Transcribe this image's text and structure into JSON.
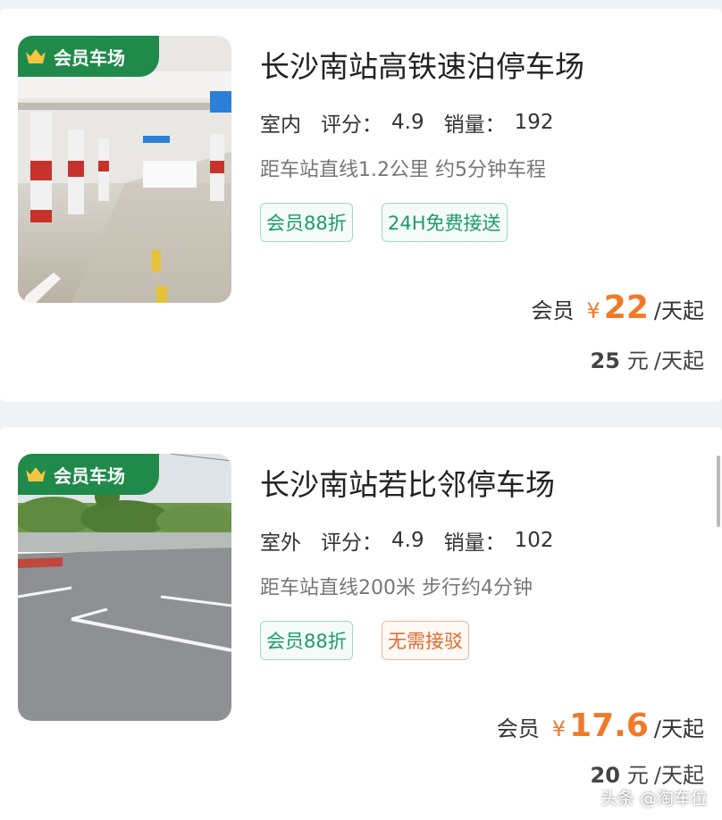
{
  "listings": [
    {
      "badge": "会员车场",
      "name": "长沙南站高铁速泊停车场",
      "environment": "室内",
      "rating_label": "评分：",
      "rating": "4.9",
      "sales_label": "销量：",
      "sales": "192",
      "distance": "距车站直线1.2公里 约5分钟车程",
      "tags": [
        {
          "text": "会员88折",
          "style": "green"
        },
        {
          "text": "24H免费接送",
          "style": "green"
        }
      ],
      "member_label": "会员",
      "currency": "¥",
      "member_price": "22",
      "per_day": "/天起",
      "original_price": "25",
      "yuan": "元"
    },
    {
      "badge": "会员车场",
      "name": "长沙南站若比邻停车场",
      "environment": "室外",
      "rating_label": "评分：",
      "rating": "4.9",
      "sales_label": "销量：",
      "sales": "102",
      "distance": "距车站直线200米 步行约4分钟",
      "tags": [
        {
          "text": "会员88折",
          "style": "green"
        },
        {
          "text": "无需接驳",
          "style": "orange"
        }
      ],
      "member_label": "会员",
      "currency": "¥",
      "member_price": "17.6",
      "per_day": "/天起",
      "original_price": "20",
      "yuan": "元"
    }
  ],
  "watermark": "头条 @淘车位",
  "colors": {
    "badge_green": "#1f8a4a",
    "price_orange": "#f07a2a",
    "tag_green": "#1e9a6c",
    "tag_orange": "#e06a2e"
  },
  "icons": [
    "crown-icon"
  ]
}
